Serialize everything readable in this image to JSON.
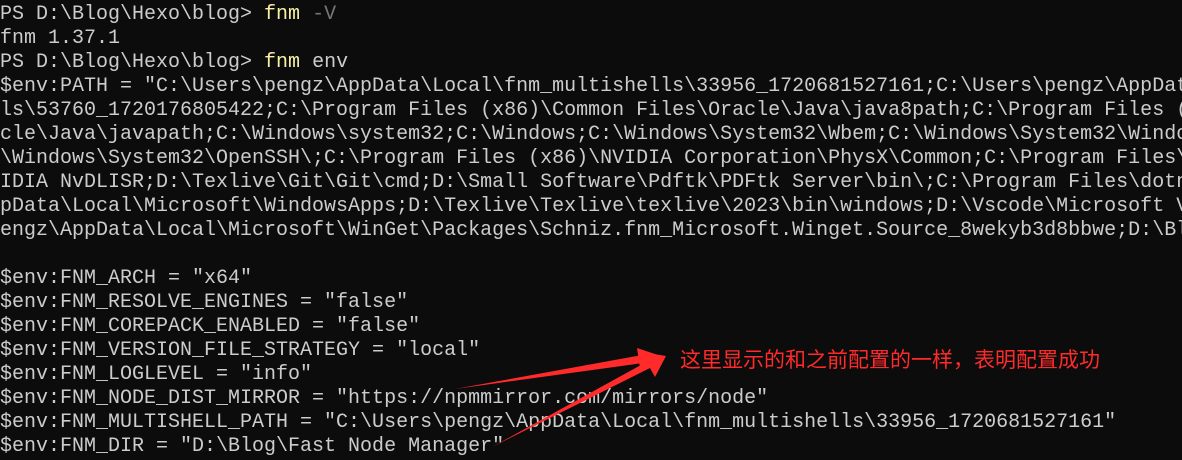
{
  "terminal": {
    "prompt": "PS D:\\Blog\\Hexo\\blog> ",
    "commands": [
      {
        "cmd": "fnm",
        "args": " -V"
      },
      {
        "cmd": "fnm",
        "args": " env"
      }
    ],
    "version_output": "fnm 1.37.1",
    "path_lines": [
      "$env:PATH = \"C:\\Users\\pengz\\AppData\\Local\\fnm_multishells\\33956_1720681527161;C:\\Users\\pengz\\AppDat",
      "ls\\53760_1720176805422;C:\\Program Files (x86)\\Common Files\\Oracle\\Java\\java8path;C:\\Program Files (",
      "cle\\Java\\javapath;C:\\Windows\\system32;C:\\Windows;C:\\Windows\\System32\\Wbem;C:\\Windows\\System32\\Windo",
      "\\Windows\\System32\\OpenSSH\\;C:\\Program Files (x86)\\NVIDIA Corporation\\PhysX\\Common;C:\\Program Files\\",
      "IDIA NvDLISR;D:\\Texlive\\Git\\Git\\cmd;D:\\Small Software\\Pdftk\\PDFtk Server\\bin\\;C:\\Program Files\\dotn",
      "pData\\Local\\Microsoft\\WindowsApps;D:\\Texlive\\Texlive\\texlive\\2023\\bin\\windows;D:\\Vscode\\Microsoft V",
      "engz\\AppData\\Local\\Microsoft\\WinGet\\Packages\\Schniz.fnm_Microsoft.Winget.Source_8wekyb3d8bbwe;D:\\Bl"
    ],
    "env_lines": [
      "$env:FNM_ARCH = \"x64\"",
      "$env:FNM_RESOLVE_ENGINES = \"false\"",
      "$env:FNM_COREPACK_ENABLED = \"false\"",
      "$env:FNM_VERSION_FILE_STRATEGY = \"local\"",
      "$env:FNM_LOGLEVEL = \"info\"",
      "$env:FNM_NODE_DIST_MIRROR = \"https://npmmirror.com/mirrors/node\"",
      "$env:FNM_MULTISHELL_PATH = \"C:\\Users\\pengz\\AppData\\Local\\fnm_multishells\\33956_1720681527161\"",
      "$env:FNM_DIR = \"D:\\Blog\\Fast Node Manager\""
    ]
  },
  "annotation": {
    "text": "这里显示的和之前配置的一样，表明配置成功",
    "color": "#ff2a2a"
  },
  "colors": {
    "background": "#0c0c0c",
    "text": "#cccccc",
    "command": "#f9f1a5",
    "dim_arg": "#767676"
  }
}
